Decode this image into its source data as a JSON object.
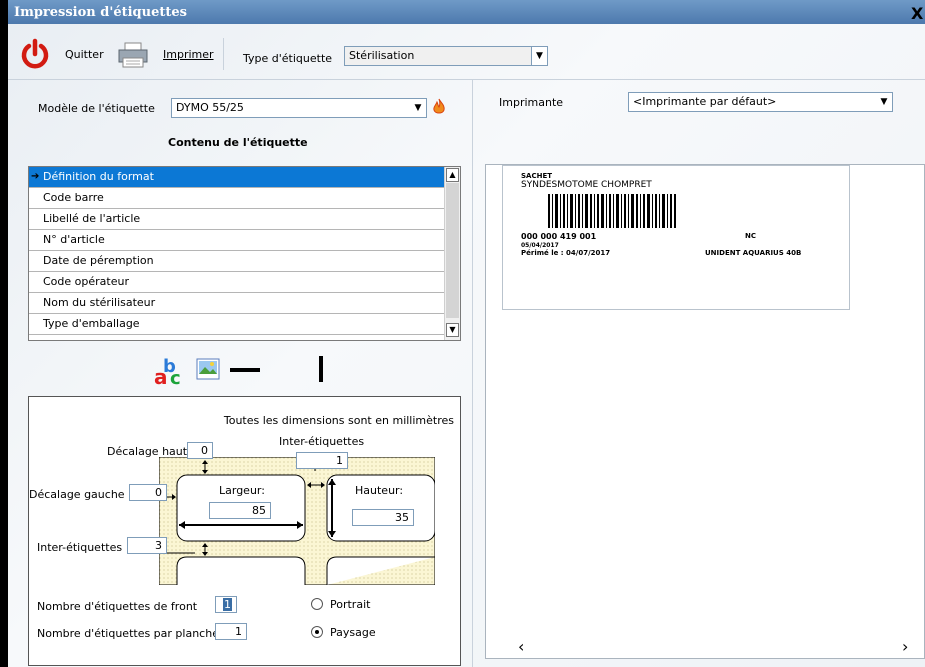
{
  "window": {
    "title": "Impression d'étiquettes",
    "close": "X"
  },
  "toolbar": {
    "quit_label": "Quitter",
    "print_label": "Imprimer",
    "label_type_label": "Type d'étiquette",
    "label_type_value": "Stérilisation"
  },
  "left": {
    "model_label": "Modèle de l'étiquette",
    "model_value": "DYMO 55/25",
    "content_title": "Contenu de l'étiquette",
    "content_items": [
      "Définition du format",
      "Code barre",
      "Libellé de l'article",
      "N° d'article",
      "Date de péremption",
      "Code opérateur",
      "Nom du stérilisateur",
      "Type d'emballage"
    ]
  },
  "dimensions": {
    "note": "Toutes les dimensions sont en millimètres",
    "top_offset_label": "Décalage haut",
    "top_offset_value": "0",
    "inter_top_label": "Inter-étiquettes",
    "inter_top_value": "1",
    "left_offset_label": "Décalage gauche",
    "left_offset_value": "0",
    "width_label": "Largeur:",
    "width_value": "85",
    "height_label": "Hauteur:",
    "height_value": "35",
    "inter_left_label": "Inter-étiquettes",
    "inter_left_value": "3",
    "front_count_label": "Nombre d'étiquettes de front",
    "front_count_value": "1",
    "sheet_count_label": "Nombre d'étiquettes par planche",
    "sheet_count_value": "1",
    "portrait_label": "Portrait",
    "landscape_label": "Paysage",
    "orientation": "Paysage"
  },
  "right": {
    "printer_label": "Imprimante",
    "printer_value": "<Imprimante par défaut>"
  },
  "preview": {
    "line1": "SACHET",
    "line2": "SYNDESMOTOME CHOMPRET",
    "code": "000 000 419 001",
    "date": "05/04/2017",
    "expiry": "Périmé le : 04/07/2017",
    "nc": "NC",
    "sterilizer": "UNIDENT AQUARIUS 40B"
  }
}
